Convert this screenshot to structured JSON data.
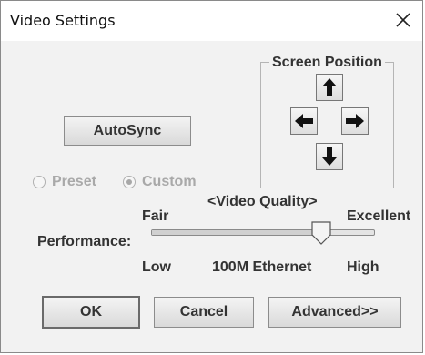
{
  "window": {
    "title": "Video Settings",
    "close_glyph": "✕"
  },
  "autosync": {
    "label": "AutoSync"
  },
  "screen_position": {
    "title": "Screen Position",
    "up_icon": "arrow-up",
    "down_icon": "arrow-down",
    "left_icon": "arrow-left",
    "right_icon": "arrow-right"
  },
  "mode": {
    "preset_label": "Preset",
    "custom_label": "Custom",
    "selected": "custom",
    "enabled": false
  },
  "performance": {
    "label": "Performance:",
    "top_left": "Fair",
    "top_center": "<Video Quality>",
    "top_right": "Excellent",
    "bottom_left": "Low",
    "bottom_center": "100M Ethernet",
    "bottom_right": "High",
    "slider_value": 0.76
  },
  "buttons": {
    "ok": "OK",
    "cancel": "Cancel",
    "advanced": "Advanced>>"
  },
  "colors": {
    "dialog_bg": "#f2f2f2",
    "title_bg": "#ffffff",
    "text": "#333333",
    "disabled_text": "#a9a9a9"
  }
}
